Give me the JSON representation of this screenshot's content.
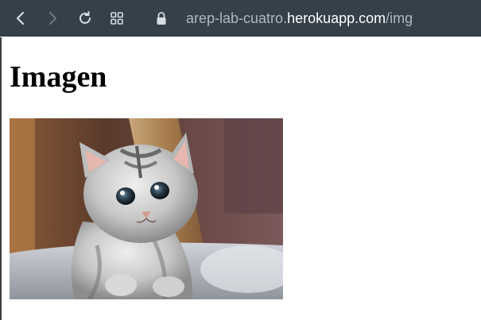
{
  "browser": {
    "url_prefix": "arep-lab-cuatro.",
    "url_host": "herokuapp.com",
    "url_path": "/img",
    "icons": {
      "back": "chevron-left-icon",
      "forward": "chevron-right-icon",
      "reload": "reload-icon",
      "tabs": "tab-grid-icon",
      "lock": "lock-icon"
    }
  },
  "page": {
    "heading": "Imagen",
    "image_subject": "kitten"
  }
}
